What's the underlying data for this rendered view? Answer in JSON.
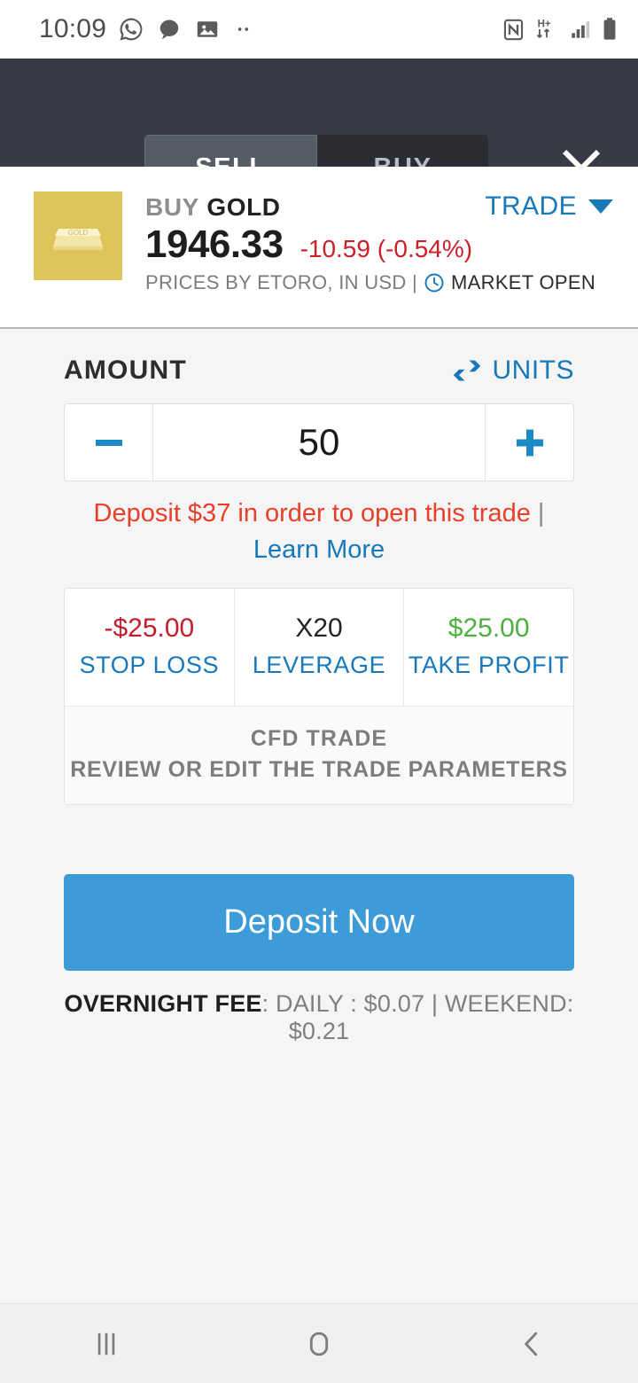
{
  "status_bar": {
    "time": "10:09",
    "left_icons": [
      "whatsapp-icon",
      "message-icon",
      "image-icon",
      "more-dots-icon"
    ],
    "right_icons": [
      "nfc-icon",
      "hplus-data-icon",
      "signal-icon",
      "battery-icon"
    ],
    "data_label": "H+"
  },
  "toolbar": {
    "sell_label": "SELL",
    "buy_label": "BUY",
    "active_tab": "SELL",
    "close_label": "close-icon",
    "bg_color": "#383b45",
    "active_color": "#565c66"
  },
  "instrument": {
    "direction": "BUY",
    "symbol": "GOLD",
    "price": "1946.33",
    "change": "-10.59  (-0.54%)",
    "change_color": "#cb2027",
    "meta_prefix": "PRICES BY ETORO, IN USD | ",
    "market_status": "MARKET OPEN",
    "trade_label": "TRADE",
    "thumb_color": "#ddc35a"
  },
  "amount": {
    "label": "AMOUNT",
    "units_label": "UNITS",
    "value": "50",
    "minus_label": "minus-icon",
    "plus_label": "plus-icon"
  },
  "warning": {
    "text": "Deposit $37 in order to open this trade",
    "separator": " | ",
    "link": "Learn More",
    "color": "#e8402a",
    "link_color": "#1779ba"
  },
  "params": {
    "stop_loss": {
      "value": "-$25.00",
      "label": "STOP LOSS"
    },
    "leverage": {
      "value": "X20",
      "label": "LEVERAGE"
    },
    "take_profit": {
      "value": "$25.00",
      "label": "TAKE PROFIT"
    },
    "cfd_title": "CFD TRADE",
    "cfd_sub": "REVIEW OR EDIT THE TRADE PARAMETERS"
  },
  "cta": {
    "label": "Deposit Now",
    "color": "#3d9bd8"
  },
  "fee": {
    "title": "OVERNIGHT FEE",
    "detail": ": DAILY : $0.07 | WEEKEND: $0.21"
  },
  "nav": {
    "recents": "recents-icon",
    "home": "home-icon",
    "back": "back-icon"
  }
}
